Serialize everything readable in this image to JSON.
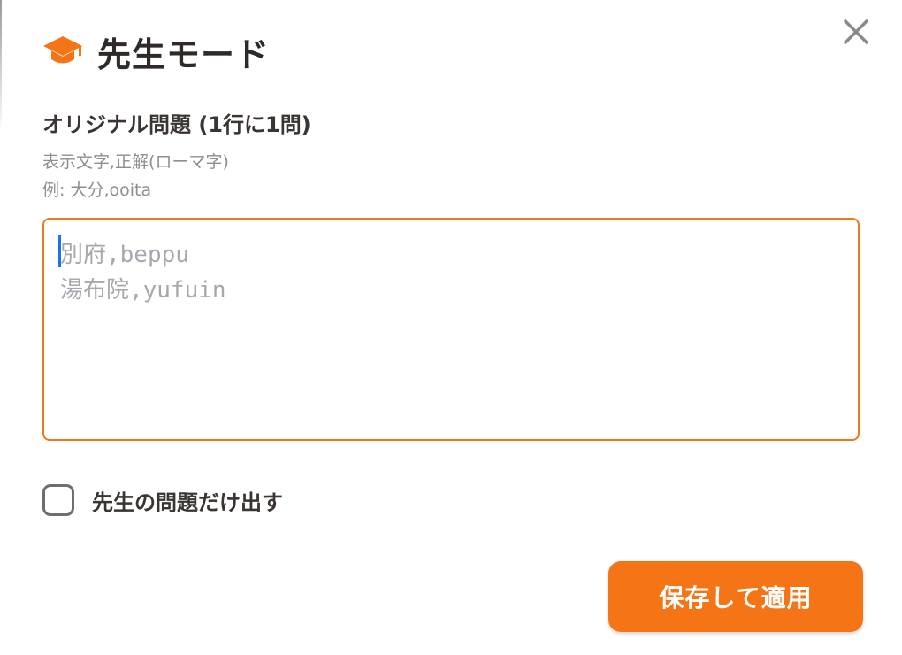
{
  "dialog": {
    "title": "先生モード",
    "title_icon": "graduation-cap-icon",
    "close_icon": "close-icon"
  },
  "questions": {
    "label": "オリジナル問題 (1行に1問)",
    "hint_format": "表示文字,正解(ローマ字)",
    "hint_example": "例: 大分,ooita",
    "textarea_value": "",
    "textarea_placeholder": "別府,beppu\n湯布院,yufuin"
  },
  "options": {
    "teacher_only_label": "先生の問題だけ出す",
    "teacher_only_checked": false
  },
  "actions": {
    "save_label": "保存して適用"
  },
  "colors": {
    "accent": "#f57415",
    "border_accent": "#ef7a1a",
    "title_text": "#2f2a28",
    "hint_text": "#8e8e8e",
    "placeholder_text": "#a5a8ae",
    "caret": "#1a73e8"
  }
}
